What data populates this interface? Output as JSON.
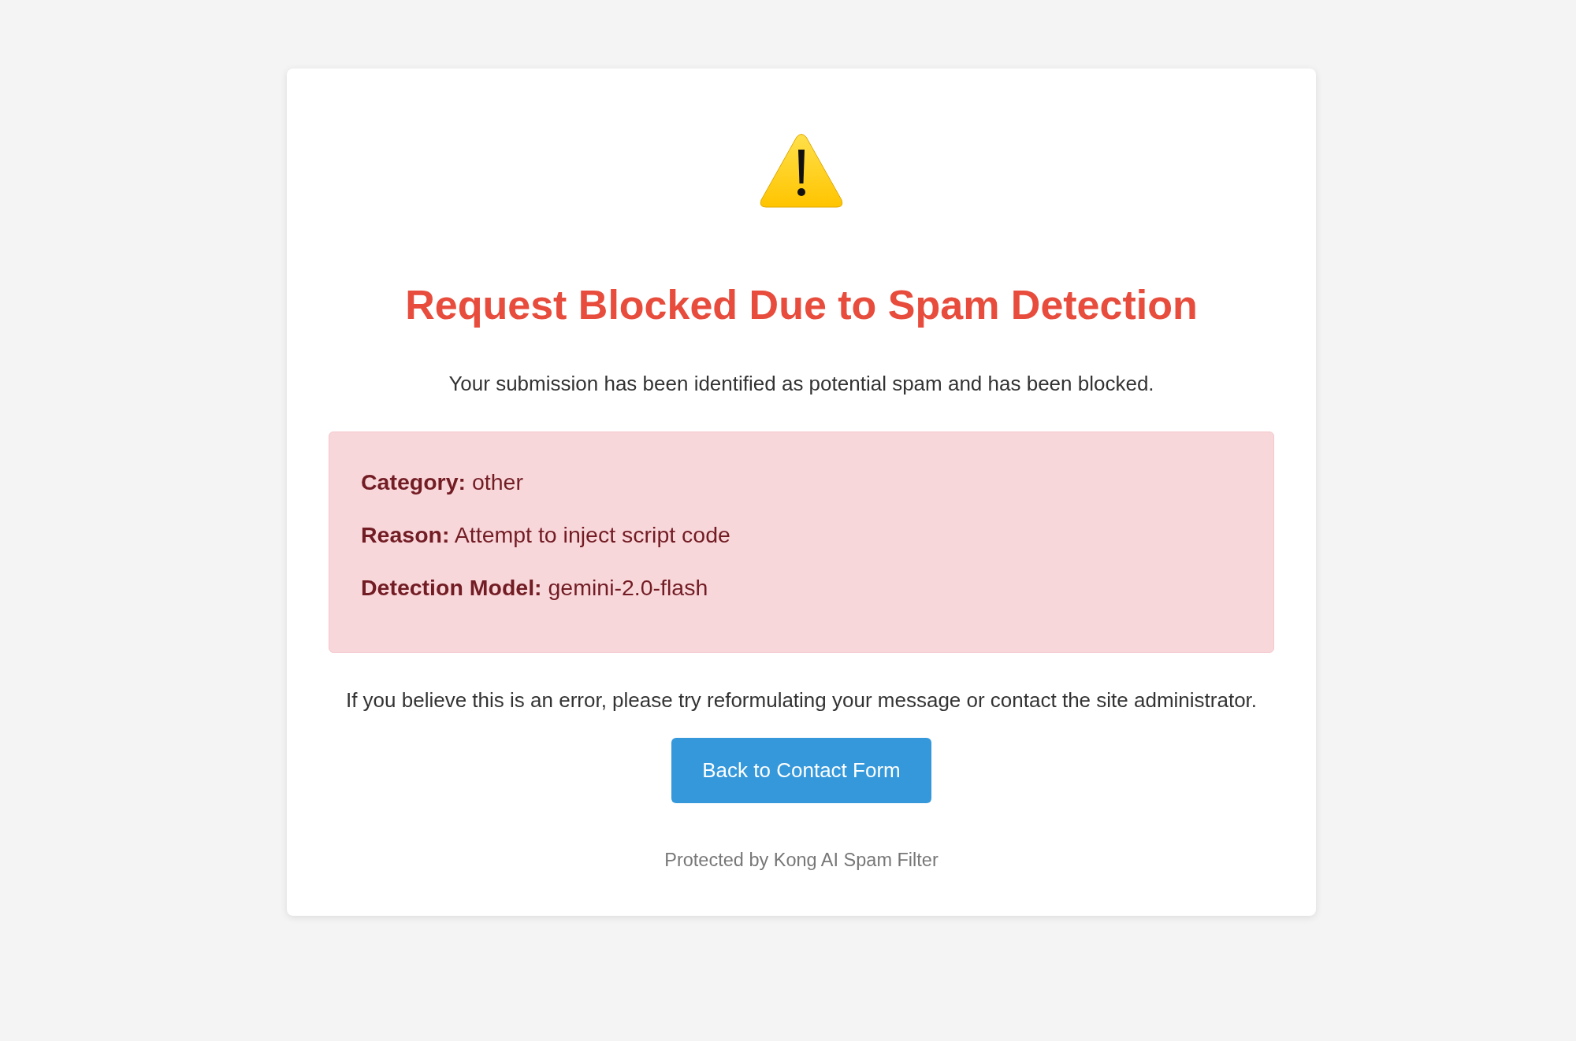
{
  "title": "Request Blocked Due to Spam Detection",
  "message": "Your submission has been identified as potential spam and has been blocked.",
  "details": [
    "**Category:** other",
    "**Reason:** Attempt to inject script code",
    "**Detection Model:** gemini-2.0-flash"
  ],
  "note": "If you believe this is an error, please try reformulating your message or contact the site administrator.",
  "button": {
    "label": "Back to Contact Form"
  },
  "footer": "Protected by Kong AI Spam Filter"
}
